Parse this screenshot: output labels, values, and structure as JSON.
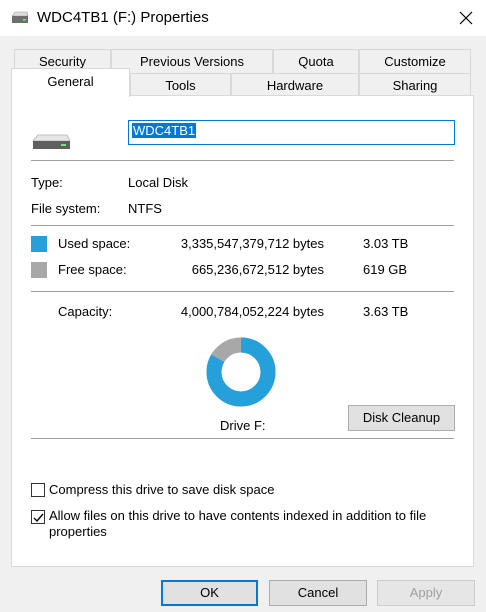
{
  "window": {
    "title": "WDC4TB1 (F:) Properties",
    "close_icon": "close-icon",
    "drive_icon": "drive-icon"
  },
  "tabs_top": [
    "Security",
    "Previous Versions",
    "Quota",
    "Customize"
  ],
  "tabs_bottom": [
    "General",
    "Tools",
    "Hardware",
    "Sharing"
  ],
  "active_tab": "General",
  "drive": {
    "name": "WDC4TB1",
    "type_label": "Type:",
    "type_value": "Local Disk",
    "fs_label": "File system:",
    "fs_value": "NTFS"
  },
  "space": {
    "used_label": "Used space:",
    "used_bytes": "3,335,547,379,712 bytes",
    "used_size": "3.03 TB",
    "used_color": "#26a0da",
    "free_label": "Free space:",
    "free_bytes": "665,236,672,512 bytes",
    "free_size": "619 GB",
    "free_color": "#a8a8a8",
    "capacity_label": "Capacity:",
    "capacity_bytes": "4,000,784,052,224 bytes",
    "capacity_size": "3.63 TB",
    "used_fraction": 0.8337
  },
  "drive_label": "Drive F:",
  "disk_cleanup_label": "Disk Cleanup",
  "options": {
    "compress": {
      "label": "Compress this drive to save disk space",
      "checked": false
    },
    "index_line1": "Allow files on this drive to have contents indexed in addition to file",
    "index_line2": "properties",
    "index_checked": true
  },
  "buttons": {
    "ok": "OK",
    "cancel": "Cancel",
    "apply": "Apply"
  }
}
